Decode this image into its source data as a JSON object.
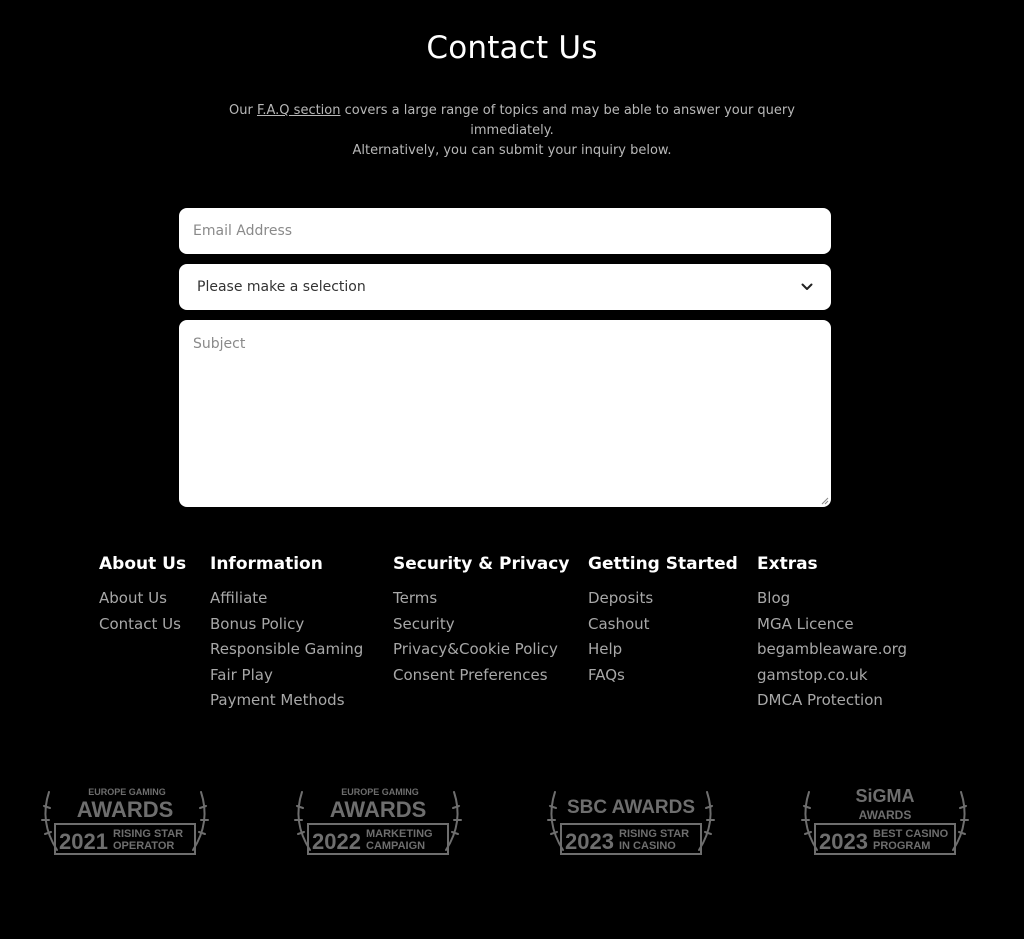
{
  "page": {
    "title": "Contact Us",
    "intro_prefix": "Our ",
    "faq_link": "F.A.Q section",
    "intro_suffix": " covers a large range of topics and may be able to answer your query immediately.",
    "intro_line2": "Alternatively, you can submit your inquiry below."
  },
  "form": {
    "email_placeholder": "Email Address",
    "select_value": "Please make a selection",
    "subject_placeholder": "Subject"
  },
  "footer": {
    "columns": [
      {
        "title": "About Us",
        "links": [
          "About Us",
          "Contact Us"
        ]
      },
      {
        "title": "Information",
        "links": [
          "Affiliate",
          "Bonus Policy",
          "Responsible Gaming",
          "Fair Play",
          "Payment Methods"
        ]
      },
      {
        "title": "Security & Privacy",
        "links": [
          "Terms",
          "Security",
          "Privacy&Cookie Policy",
          "Consent Preferences"
        ]
      },
      {
        "title": "Getting Started",
        "links": [
          "Deposits",
          "Cashout",
          "Help",
          "FAQs"
        ]
      },
      {
        "title": "Extras",
        "links": [
          "Blog",
          "MGA Licence",
          "begambleaware.org",
          "gamstop.co.uk",
          "DMCA Protection"
        ]
      }
    ]
  },
  "awards": [
    {
      "top1": "EUROPE GAMING",
      "top2": "AWARDS",
      "year": "2021",
      "line1": "RISING STAR",
      "line2": "OPERATOR"
    },
    {
      "top1": "EUROPE GAMING",
      "top2": "AWARDS",
      "year": "2022",
      "line1": "MARKETING",
      "line2": "CAMPAIGN"
    },
    {
      "top1": "SBC AWARDS",
      "top2": "",
      "year": "2023",
      "line1": "RISING STAR",
      "line2": "IN CASINO"
    },
    {
      "top1": "SiGMA",
      "top2": "AWARDS",
      "year": "2023",
      "line1": "BEST CASINO",
      "line2": "PROGRAM"
    }
  ],
  "colors": {
    "background": "#000000",
    "heading": "#ffffff",
    "muted_text": "#a8a8a8",
    "field_bg": "#ffffff",
    "award_gray": "#6e6e6e"
  }
}
